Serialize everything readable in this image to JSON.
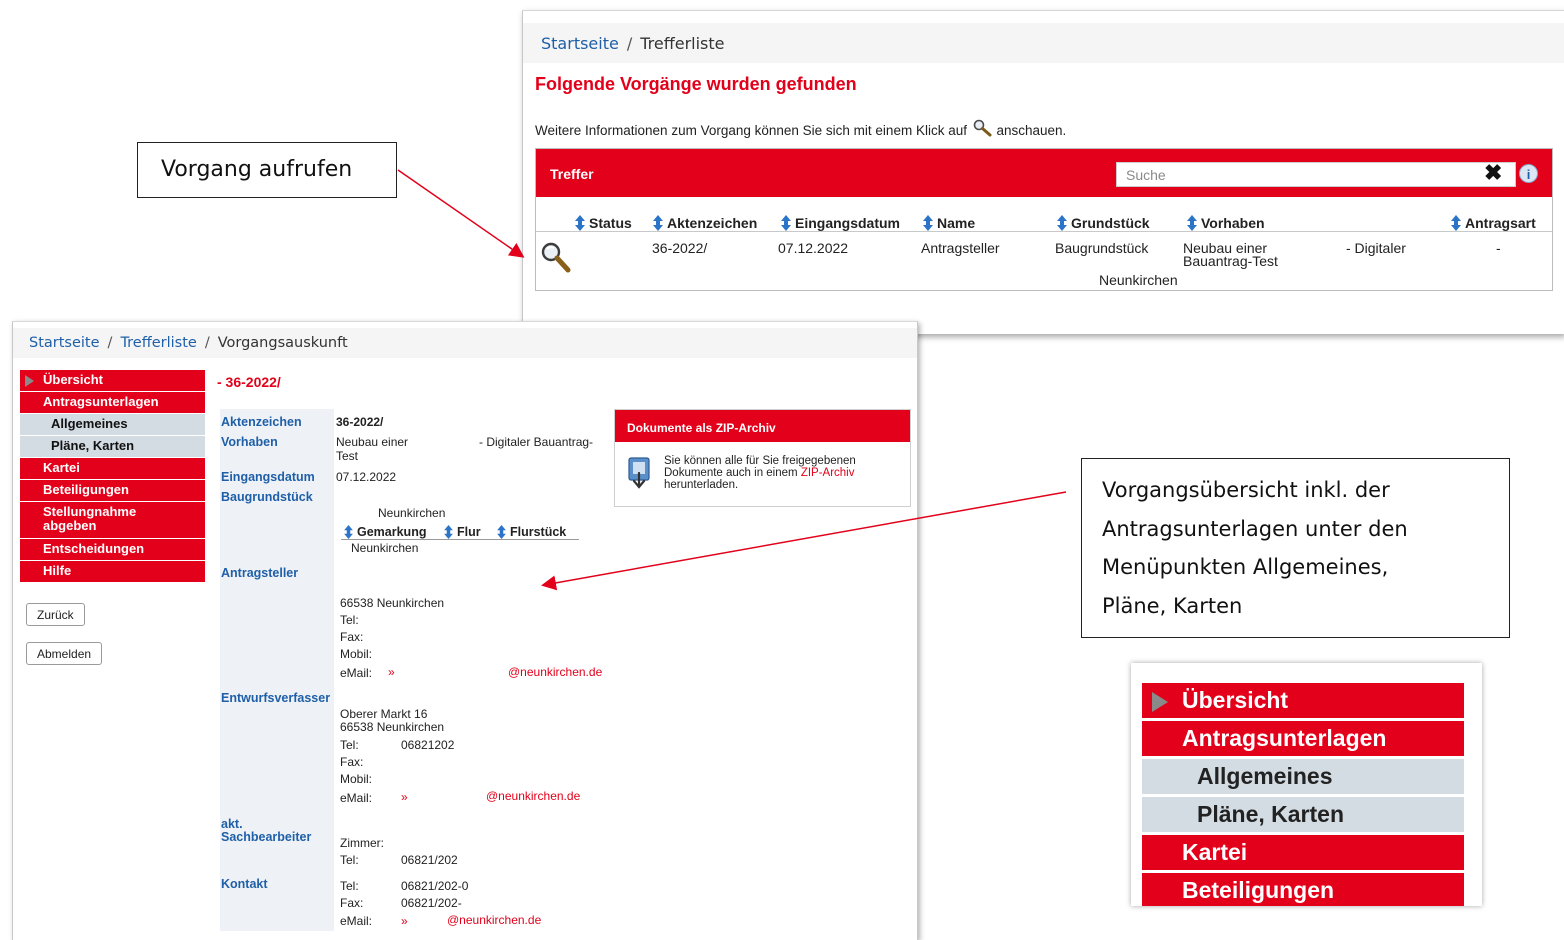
{
  "hit_list": {
    "breadcrumb": {
      "home": "Startseite",
      "separator": "/",
      "current": "Trefferliste"
    },
    "headline": "Folgende Vorgänge wurden gefunden",
    "info_before": "Weitere Informationen zum Vorgang können Sie sich mit einem Klick auf",
    "info_after": "anschauen.",
    "table_title": "Treffer",
    "search_placeholder": "Suche",
    "columns": [
      "Status",
      "Aktenzeichen",
      "Eingangsdatum",
      "Name",
      "Grundstück",
      "Vorhaben",
      "Antragsart"
    ],
    "row": {
      "aktenzeichen": "36-2022/",
      "eingangsdatum": "07.12.2022",
      "name": "Antragsteller",
      "grundstueck_1": "Baugrundstück",
      "grundstueck_2": "Neunkirchen",
      "vorhaben_1": "Neubau einer",
      "vorhaben_2": "Bauantrag-Test",
      "vorhaben_3": "- Digitaler",
      "antragsart": "-"
    }
  },
  "annotations": {
    "call_case": "Vorgang aufrufen",
    "overview_lines": [
      "Vorgangsübersicht inkl. der",
      "Antragsunterlagen unter den",
      "Menüpunkten Allgemeines,",
      "Pläne, Karten"
    ]
  },
  "detail": {
    "breadcrumb": {
      "home": "Startseite",
      "list": "Trefferliste",
      "current": "Vorgangsauskunft",
      "separator": "/"
    },
    "menu": [
      "Übersicht",
      "Antragsunterlagen",
      "Allgemeines",
      "Pläne, Karten",
      "Kartei",
      "Beteiligungen",
      "Stellungnahme abgeben",
      "Entscheidungen",
      "Hilfe"
    ],
    "buttons": {
      "back": "Zurück",
      "logout": "Abmelden"
    },
    "case_title": "- 36-2022/",
    "labels": {
      "aktenzeichen": "Aktenzeichen",
      "vorhaben": "Vorhaben",
      "eingangsdatum": "Eingangsdatum",
      "baugrundstueck": "Baugrundstück",
      "antragsteller": "Antragsteller",
      "entwurfsverfasser": "Entwurfsverfasser",
      "sachbearbeiter_1": "akt.",
      "sachbearbeiter_2": "Sachbearbeiter",
      "kontakt": "Kontakt"
    },
    "values": {
      "aktenzeichen": "36-2022/",
      "vorhaben_1": "Neubau einer",
      "vorhaben_2": "Test",
      "vorhaben_3": "- Digitaler Bauantrag-",
      "eingangsdatum": "07.12.2022",
      "grundstueck_ort": "Neunkirchen",
      "parcel_columns": [
        "Gemarkung",
        "Flur",
        "Flurstück"
      ],
      "parcel_gemarkung": "Neunkirchen",
      "antragsteller_ort": "66538 Neunkirchen",
      "tel": "Tel:",
      "fax": "Fax:",
      "mobil": "Mobil:",
      "email": "eMail:",
      "email_arrow": "»",
      "email_domain": "@neunkirchen.de",
      "ev_street": "Oberer Markt 16",
      "ev_city": "66538 Neunkirchen",
      "ev_tel": "06821202",
      "sb_zimmer": "Zimmer:",
      "sb_tel": "06821/202",
      "k_tel": "06821/202-0",
      "k_fax": "06821/202-"
    },
    "zip": {
      "title": "Dokumente als ZIP-Archiv",
      "line_1": "Sie können alle für Sie freigegebenen",
      "line_2": "Dokumente auch in einem",
      "link": "ZIP-Archiv",
      "line_3": "herunterladen."
    }
  },
  "zoom_menu": [
    "Übersicht",
    "Antragsunterlagen",
    "Allgemeines",
    "Pläne, Karten",
    "Kartei",
    "Beteiligungen"
  ],
  "colors": {
    "accent_red": "#e2001a",
    "menu_sub_bg": "#d3dbe3",
    "link_blue": "#1f5fa8",
    "arrow_red": "#e2001a"
  }
}
